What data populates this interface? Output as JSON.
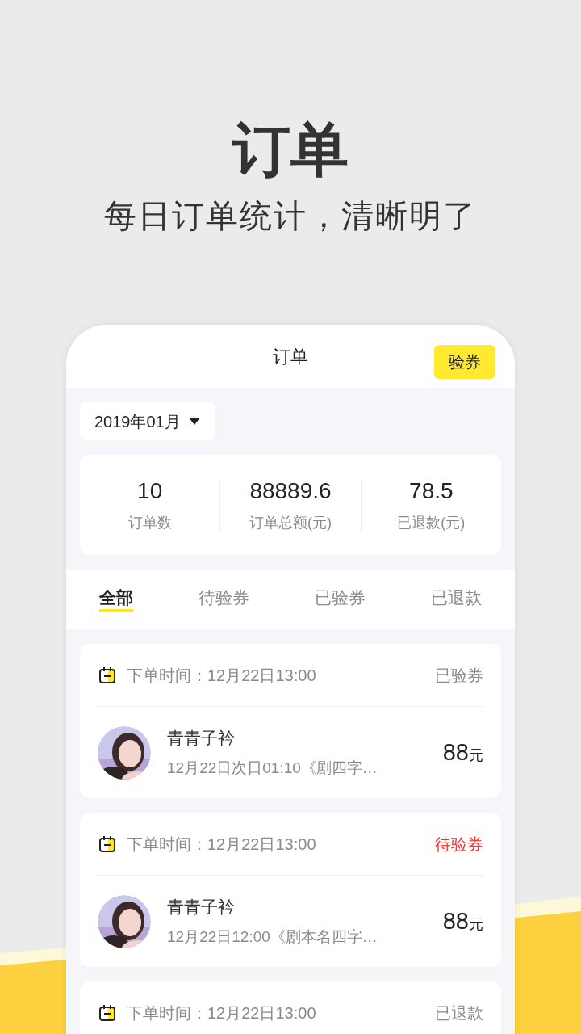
{
  "headline": "订单",
  "subtitle": "每日订单统计，清晰明了",
  "app": {
    "title": "订单",
    "action_button": "验券",
    "month_picker": "2019年01月",
    "stats": [
      {
        "value": "10",
        "label": "订单数"
      },
      {
        "value": "88889.6",
        "label": "订单总额(元)"
      },
      {
        "value": "78.5",
        "label": "已退款(元)"
      }
    ],
    "tabs": [
      {
        "label": "全部",
        "selected": true
      },
      {
        "label": "待验券",
        "selected": false
      },
      {
        "label": "已验券",
        "selected": false
      },
      {
        "label": "已退款",
        "selected": false
      }
    ],
    "orders": [
      {
        "time": "下单时间：12月22日13:00",
        "status": "已验券",
        "kind": "done",
        "name": "青青子衿",
        "detail": "12月22日次日01:10《剧四字…",
        "price": "88",
        "unit": "元"
      },
      {
        "time": "下单时间：12月22日13:00",
        "status": "待验券",
        "kind": "pending",
        "name": "青青子衿",
        "detail": "12月22日12:00《剧本名四字…",
        "price": "88",
        "unit": "元"
      },
      {
        "time": "下单时间：12月22日13:00",
        "status": "已退款",
        "kind": "done"
      }
    ]
  }
}
